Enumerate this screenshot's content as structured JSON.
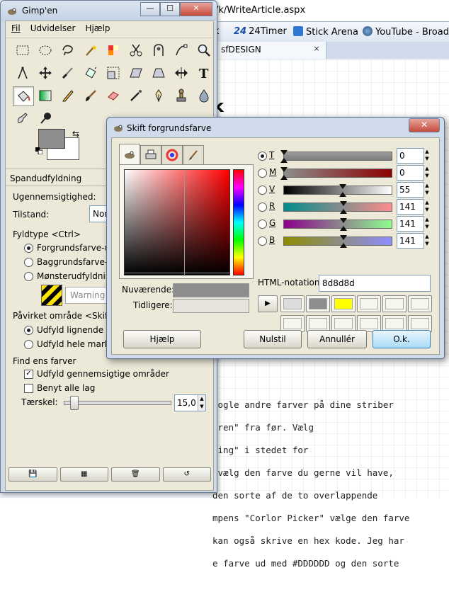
{
  "browser": {
    "address": "/k/WriteArticle.aspx",
    "favorites": [
      {
        "label": "k",
        "color": "#3b6dbf"
      },
      {
        "label": "24Timer",
        "color": "#ffffff"
      },
      {
        "label": "Stick Arena",
        "color": "#2f78d2"
      },
      {
        "label": "YouTube - Broadca",
        "color": "#4a4a4a"
      }
    ],
    "favorites_prefix": "24",
    "tab_label": "sfDESIGN",
    "tab_close": "×",
    "heading_char": "k",
    "article_lines": [
      "nogle andre farver på dine striber",
      "eren\" fra før. Vælg",
      "ning\" i stedet for",
      " vælg den farve du gerne vil have,",
      "den sorte af de to overlappende",
      "mpens \"Corlor Picker\" vælge den farve",
      "kan også skrive en hex kode. Jeg har",
      "e farve ud med #DDDDDD og den sorte"
    ]
  },
  "gimp": {
    "title": "Gimp'en",
    "window_buttons": [
      "—",
      "☐",
      "✕"
    ],
    "menu": [
      "Fil",
      "Udvidelser",
      "Hjælp"
    ],
    "fg_color": "#8d8d8d",
    "bg_color": "#ffffff",
    "tool_options_title": "Spandudfyldning",
    "opacity_label": "Ugennemsigtighed:",
    "mode_label": "Tilstand:",
    "mode_value": "Nor",
    "fill_type_label": "Fyldtype  <Ctrl>",
    "fill_types": [
      "Forgrundsfarve-udf",
      "Baggrundsfarve-ud",
      "Mønsterudfyldning"
    ],
    "fill_type_selected": 0,
    "pattern_warning": "Warning!",
    "affected_label": "Påvirket område  <Skift>",
    "affected": [
      "Udfyld lignende far",
      "Udfyld hele marker"
    ],
    "affected_selected": 0,
    "find_label": "Find ens farver",
    "transparent_label": "Udfyld gennemsigtige områder",
    "transparent_checked": true,
    "all_layers_label": "Benyt alle lag",
    "all_layers_checked": false,
    "threshold_label": "Tærskel:",
    "threshold_value": "15,0",
    "threshold_fraction": 0.06
  },
  "dialog": {
    "title": "Skift forgrundsfarve",
    "close": "✕",
    "channels": [
      {
        "key": "T",
        "value": "0",
        "selected": true
      },
      {
        "key": "M",
        "value": "0",
        "selected": false
      },
      {
        "key": "V",
        "value": "55",
        "selected": false
      },
      {
        "key": "R",
        "value": "141",
        "selected": false
      },
      {
        "key": "G",
        "value": "141",
        "selected": false
      },
      {
        "key": "B",
        "value": "141",
        "selected": false
      }
    ],
    "html_label": "HTML-notation:",
    "html_value": "8d8d8d",
    "current_label": "Nuværende:",
    "previous_label": "Tidligere:",
    "current_color": "#8d8d8d",
    "previous_color": "#e6e4dc",
    "history_colors": [
      "#dcdcdc",
      "#8d8d8d",
      "#ffff00",
      "#f6f5ee",
      "#f6f5ee",
      "#f6f5ee",
      "#f6f5ee",
      "#f6f5ee",
      "#f6f5ee",
      "#f6f5ee",
      "#f6f5ee",
      "#f6f5ee"
    ],
    "buttons": {
      "help": "Hjælp",
      "reset": "Nulstil",
      "cancel": "Annullér",
      "ok": "O.k."
    }
  }
}
